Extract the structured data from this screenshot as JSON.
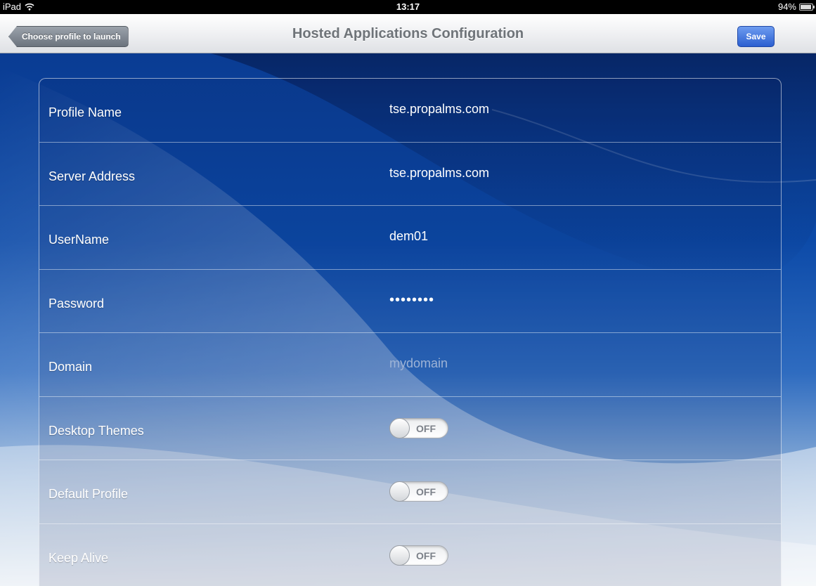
{
  "status_bar": {
    "device": "iPad",
    "time": "13:17",
    "battery": "94%"
  },
  "nav": {
    "back_label": "Choose profile to launch",
    "title": "Hosted Applications Configuration",
    "save_label": "Save"
  },
  "fields": [
    {
      "label": "Profile Name",
      "value": "tse.propalms.com"
    },
    {
      "label": "Server Address",
      "value": "tse.propalms.com"
    },
    {
      "label": "UserName",
      "value": "dem01"
    },
    {
      "label": "Password",
      "value": "••••••••"
    },
    {
      "label": "Domain",
      "placeholder": "mydomain"
    }
  ],
  "toggles": [
    {
      "label": "Desktop Themes",
      "state": "OFF"
    },
    {
      "label": "Default Profile",
      "state": "OFF"
    },
    {
      "label": "Keep Alive",
      "state": "OFF"
    }
  ],
  "colors": {
    "background": "#0c4aa8",
    "save_button": "#2b5fd0"
  }
}
